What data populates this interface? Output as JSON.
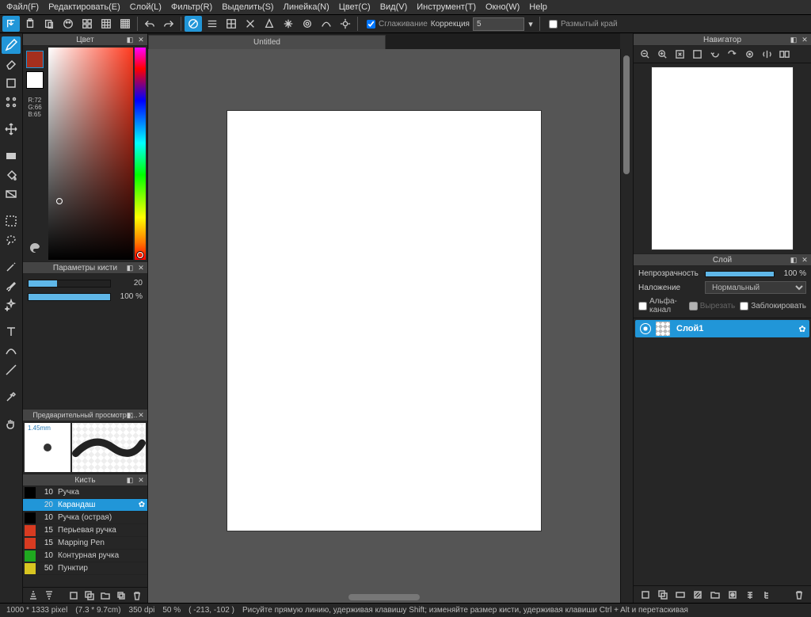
{
  "menu": [
    "Файл(F)",
    "Редактировать(E)",
    "Слой(L)",
    "Фильтр(R)",
    "Выделить(S)",
    "Линейка(N)",
    "Цвет(C)",
    "Вид(V)",
    "Инструмент(T)",
    "Окно(W)",
    "Help"
  ],
  "topbar": {
    "smoothing_check_label": "Сглаживание",
    "correction_label": "Коррекция",
    "correction_value": "5",
    "blurred_edge_label": "Размытый край"
  },
  "doc_tab": "Untitled",
  "panels": {
    "color_title": "Цвет",
    "rgb": {
      "r": "R:72",
      "g": "G:66",
      "b": "B:65"
    },
    "brush_params_title": "Параметры кисти",
    "brush_size_value": "20",
    "brush_opacity_value": "100 %",
    "brush_preview_title": "Предварительный просмотр к...",
    "brush_tip_size": "1.45mm",
    "brush_list_title": "Кисть",
    "nav_title": "Навигатор",
    "layer_title": "Слой"
  },
  "brushes": [
    {
      "color": "#000000",
      "size": "10",
      "name": "Ручка"
    },
    {
      "color": "#2196d8",
      "size": "20",
      "name": "Карандаш",
      "selected": true
    },
    {
      "color": "#000000",
      "size": "10",
      "name": "Ручка (острая)"
    },
    {
      "color": "#d83b21",
      "size": "15",
      "name": "Перьевая ручка"
    },
    {
      "color": "#d83b21",
      "size": "15",
      "name": "Mapping Pen"
    },
    {
      "color": "#1fa81f",
      "size": "10",
      "name": "Контурная ручка"
    },
    {
      "color": "#d8c521",
      "size": "50",
      "name": "Пунктир"
    }
  ],
  "layer": {
    "opacity_label": "Непрозрачность",
    "opacity_value": "100 %",
    "blend_label": "Наложение",
    "blend_value": "Нормальный",
    "alpha_label": "Альфа-канал",
    "clip_label": "Вырезать",
    "lock_label": "Заблокировать",
    "layer1": "Слой1"
  },
  "status": {
    "dims": "1000 * 1333 pixel",
    "phys": "(7.3 * 9.7cm)",
    "dpi": "350 dpi",
    "zoom": "50 %",
    "coords": "( -213, -102 )",
    "hint": "Рисуйте прямую линию, удерживая клавишу Shift; изменяйте размер кисти, удерживая клавиши Ctrl + Alt и перетаскивая"
  }
}
